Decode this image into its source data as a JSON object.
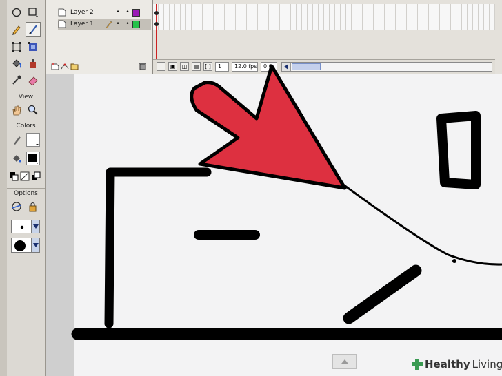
{
  "layers": [
    {
      "name": "Layer 2",
      "color": "#9b1ab7"
    },
    {
      "name": "Layer 1",
      "color": "#26c24a"
    }
  ],
  "toolbox": {
    "view_label": "View",
    "colors_label": "Colors",
    "options_label": "Options"
  },
  "timeline": {
    "current_frame": "1",
    "frame_rate": "12.0 fps",
    "elapsed": "0.0"
  },
  "watermark": {
    "brand": "Healthy",
    "brand2": "Living"
  },
  "colors": {
    "arrow_red": "#dd3040",
    "stroke": "#000000"
  }
}
